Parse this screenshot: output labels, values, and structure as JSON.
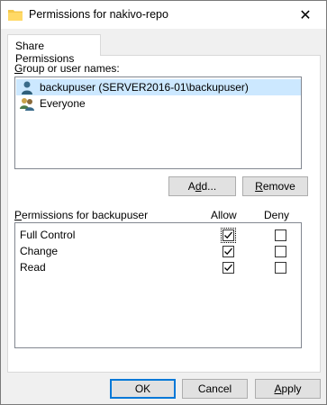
{
  "window": {
    "title": "Permissions for nakivo-repo",
    "close_glyph": "✕"
  },
  "tab": {
    "label": "Share Permissions"
  },
  "group": {
    "label_prefix": "",
    "label_accel": "G",
    "label_rest": "roup or user names:",
    "users": [
      {
        "name": "backupuser (SERVER2016-01\\backupuser)",
        "icon": "user-icon",
        "selected": true
      },
      {
        "name": "Everyone",
        "icon": "users-group-icon",
        "selected": false
      }
    ]
  },
  "buttons": {
    "add_accel": "d",
    "add_pre": "A",
    "add_post": "d...",
    "remove_accel": "R",
    "remove_rest": "emove",
    "ok": "OK",
    "cancel": "Cancel",
    "apply_accel": "A",
    "apply_rest": "pply"
  },
  "permissions": {
    "label_accel": "P",
    "label_rest": "ermissions for backupuser",
    "col_allow": "Allow",
    "col_deny": "Deny",
    "rows": [
      {
        "name": "Full Control",
        "allow": true,
        "deny": false
      },
      {
        "name": "Change",
        "allow": true,
        "deny": false
      },
      {
        "name": "Read",
        "allow": true,
        "deny": false
      }
    ]
  }
}
